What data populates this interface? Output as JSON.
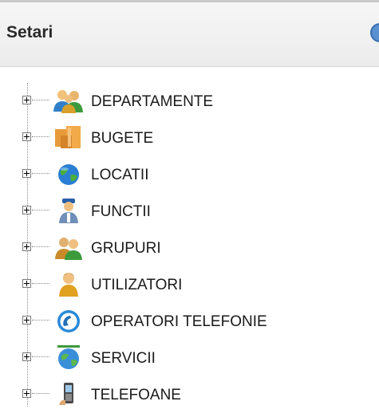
{
  "header": {
    "title": "Setari"
  },
  "tree": {
    "items": [
      {
        "label": "DEPARTAMENTE",
        "icon": "users-group-icon"
      },
      {
        "label": "BUGETE",
        "icon": "budget-boxes-icon"
      },
      {
        "label": "LOCATII",
        "icon": "globe-icon"
      },
      {
        "label": "FUNCTII",
        "icon": "role-person-icon"
      },
      {
        "label": "GRUPURI",
        "icon": "group-icon"
      },
      {
        "label": "UTILIZATORI",
        "icon": "user-icon"
      },
      {
        "label": "OPERATORI TELEFONIE",
        "icon": "phone-operator-icon"
      },
      {
        "label": "SERVICII",
        "icon": "services-globe-icon"
      },
      {
        "label": "TELEFOANE",
        "icon": "mobile-phone-icon"
      }
    ]
  }
}
